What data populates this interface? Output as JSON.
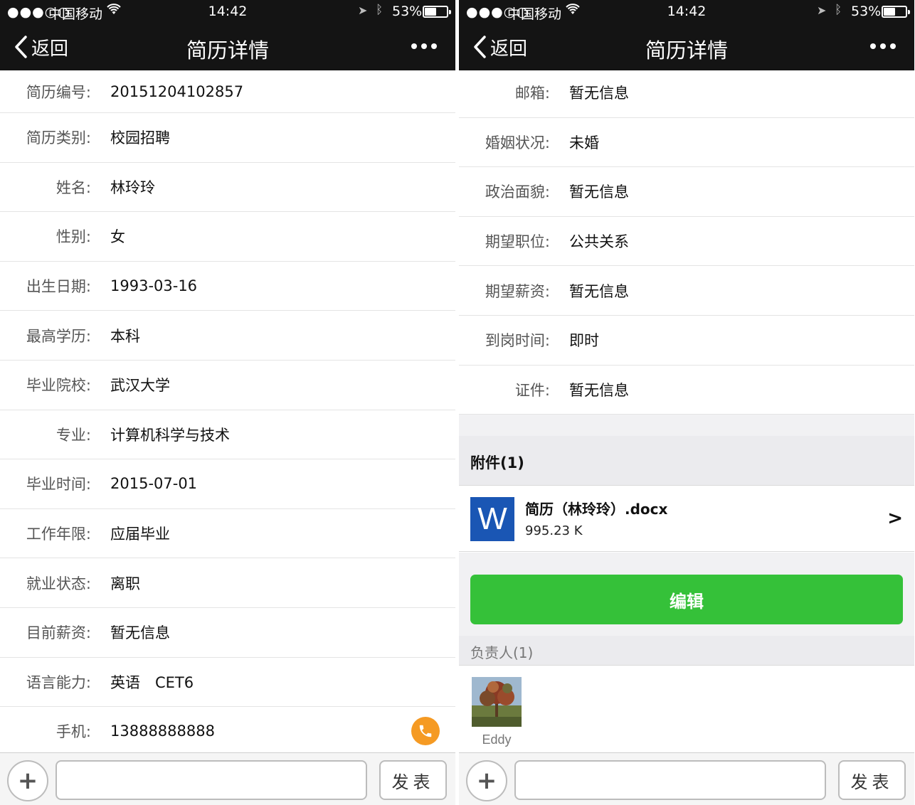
{
  "status": {
    "signal": "●●●○○",
    "carrier": "中国移动",
    "time": "14:42",
    "battery_percent": "53%",
    "battery_level": 0.53
  },
  "nav": {
    "back_label": "返回",
    "title": "简历详情"
  },
  "left_fields": [
    {
      "label": "简历编号:",
      "value": "20151204102857"
    },
    {
      "label": "简历类别:",
      "value": "校园招聘"
    },
    {
      "label": "姓名:",
      "value": "林玲玲"
    },
    {
      "label": "性别:",
      "value": "女"
    },
    {
      "label": "出生日期:",
      "value": "1993-03-16"
    },
    {
      "label": "最高学历:",
      "value": "本科"
    },
    {
      "label": "毕业院校:",
      "value": "武汉大学"
    },
    {
      "label": "专业:",
      "value": "计算机科学与技术"
    },
    {
      "label": "毕业时间:",
      "value": "2015-07-01"
    },
    {
      "label": "工作年限:",
      "value": "应届毕业"
    },
    {
      "label": "就业状态:",
      "value": "离职"
    },
    {
      "label": "目前薪资:",
      "value": "暂无信息"
    },
    {
      "label": "语言能力:",
      "value": "英语　CET6"
    },
    {
      "label": "手机:",
      "value": "13888888888"
    }
  ],
  "right_fields": [
    {
      "label": "邮箱:",
      "value": "暂无信息"
    },
    {
      "label": "婚姻状况:",
      "value": "未婚"
    },
    {
      "label": "政治面貌:",
      "value": "暂无信息"
    },
    {
      "label": "期望职位:",
      "value": "公共关系"
    },
    {
      "label": "期望薪资:",
      "value": "暂无信息"
    },
    {
      "label": "到岗时间:",
      "value": "即时"
    },
    {
      "label": "证件:",
      "value": "暂无信息"
    }
  ],
  "attachments": {
    "header": "附件(1)",
    "items": [
      {
        "icon_letter": "W",
        "name": "简历（林玲玲）.docx",
        "size": "995.23 K",
        "chevron": ">"
      }
    ]
  },
  "edit_label": "编辑",
  "owners": {
    "header": "负责人(1)",
    "items": [
      {
        "name": "Eddy"
      }
    ]
  },
  "composer": {
    "plus": "+",
    "send_label": "发表",
    "placeholder": ""
  },
  "colors": {
    "bar": "#141414",
    "accent_green": "#35c139",
    "phone_orange": "#f59a23",
    "word_blue": "#1a56b4"
  }
}
